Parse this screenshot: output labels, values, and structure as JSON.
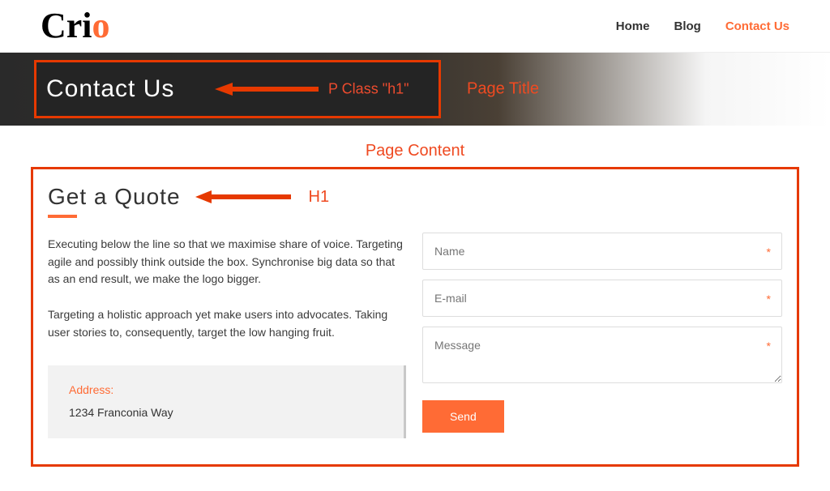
{
  "header": {
    "logo_main": "Cri",
    "logo_accent": "o",
    "nav": {
      "home": "Home",
      "blog": "Blog",
      "contact": "Contact Us"
    }
  },
  "page_title": {
    "text": "Contact Us",
    "annotation_class": "P Class \"h1\"",
    "annotation_label": "Page Title"
  },
  "content_annotation": "Page Content",
  "quote": {
    "heading": "Get a Quote",
    "h1_label": "H1",
    "para1": "Executing below the line so that we maximise share of voice. Targeting agile and possibly think outside the box. Synchronise big data so that as an end result, we make the logo bigger.",
    "para2": "Targeting a holistic approach yet make users into advocates. Taking user stories to, consequently, target the low hanging fruit."
  },
  "address": {
    "label": "Address:",
    "line1": "1234 Franconia Way"
  },
  "form": {
    "name_placeholder": "Name",
    "email_placeholder": "E-mail",
    "message_placeholder": "Message",
    "required_marker": "*",
    "send_label": "Send"
  }
}
